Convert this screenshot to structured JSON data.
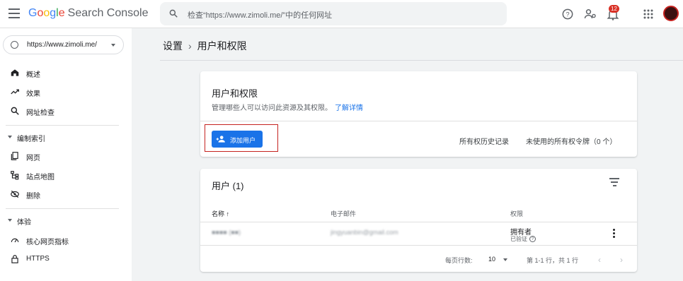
{
  "app": {
    "logo_google": [
      "G",
      "o",
      "o",
      "g",
      "l",
      "e"
    ],
    "logo_product": "Search Console"
  },
  "search": {
    "placeholder": "检查“https://www.zimoli.me/”中的任何网址"
  },
  "header": {
    "notification_count": "12"
  },
  "property": {
    "label": "https://www.zimoli.me/"
  },
  "sidebar": {
    "items": [
      {
        "label": "概述",
        "icon": "home-icon"
      },
      {
        "label": "效果",
        "icon": "trending-up-icon"
      },
      {
        "label": "网址检查",
        "icon": "search-icon"
      }
    ],
    "section_index": "编制索引",
    "index_items": [
      {
        "label": "网页",
        "icon": "pages-icon"
      },
      {
        "label": "站点地图",
        "icon": "sitemap-icon"
      },
      {
        "label": "删除",
        "icon": "removal-icon"
      }
    ],
    "section_experience": "体验",
    "experience_items": [
      {
        "label": "核心网页指标",
        "icon": "speed-icon"
      },
      {
        "label": "HTTPS",
        "icon": "lock-icon"
      }
    ]
  },
  "breadcrumb": {
    "parent": "设置",
    "current": "用户和权限"
  },
  "permissions_card": {
    "title": "用户和权限",
    "description": "管理哪些人可以访问此资源及其权限。",
    "learn_more": "了解详情",
    "add_user": "添加用户",
    "ownership_history": "所有权历史记录",
    "unused_tokens": "未使用的所有权令牌（0 个）"
  },
  "users_card": {
    "title": "用户 (1)",
    "columns": {
      "name": "名称",
      "email": "电子邮件",
      "permission": "权限"
    },
    "rows": [
      {
        "name": "■■■■ (■■)",
        "email": "jingyuanbin@gmail.com",
        "permission": "拥有者",
        "status": "已验证"
      }
    ],
    "rows_per_page_label": "每页行数:",
    "rows_per_page": "10",
    "range": "第 1-1 行，共 1 行"
  },
  "colors": {
    "accent": "#1a73e8",
    "highlight": "#c5221f",
    "badge": "#d93025"
  }
}
